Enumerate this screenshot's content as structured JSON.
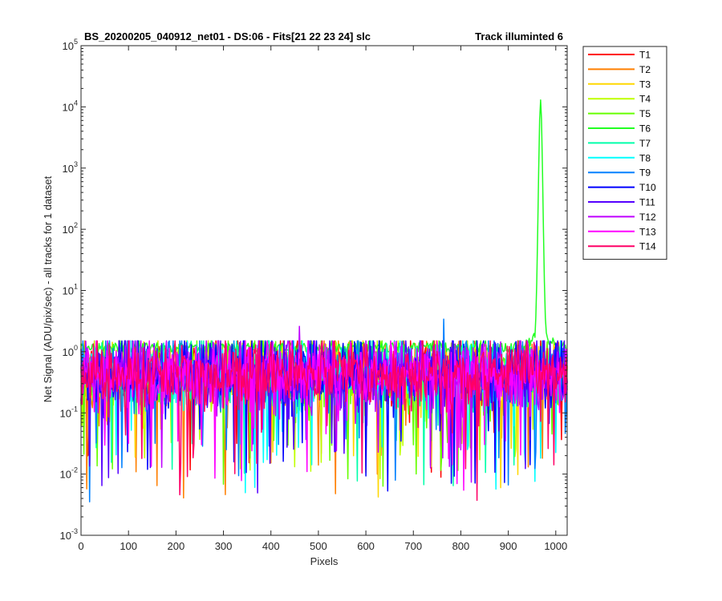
{
  "chart_data": {
    "type": "line",
    "title_left": "BS_20200205_040912_net01 - DS:06 - Fits[21  22  23  24]   slc",
    "title_right": "Track illuminted 6",
    "xlabel": "Pixels",
    "ylabel": "Net Signal (ADU/pix/sec) - all tracks for 1 dataset",
    "xlim": [
      0,
      1024
    ],
    "ylim": [
      0.001,
      100000
    ],
    "yscale": "log",
    "x_ticks": [
      "0",
      "100",
      "200",
      "300",
      "400",
      "500",
      "600",
      "700",
      "800",
      "900",
      "1000"
    ],
    "x_tick_values": [
      0,
      100,
      200,
      300,
      400,
      500,
      600,
      700,
      800,
      900,
      1000
    ],
    "y_tick_base": "10",
    "y_tick_exponents": [
      "-3",
      "-2",
      "-1",
      "0",
      "1",
      "2",
      "3",
      "4",
      "5"
    ],
    "legend_position": "outside-right-top",
    "grid": false,
    "noise_range": [
      0.003,
      1.5
    ],
    "series": [
      {
        "name": "T1",
        "color": "#ff0000"
      },
      {
        "name": "T2",
        "color": "#ff7f00"
      },
      {
        "name": "T3",
        "color": "#ffd700"
      },
      {
        "name": "T4",
        "color": "#bfff00"
      },
      {
        "name": "T5",
        "color": "#66ff00"
      },
      {
        "name": "T6",
        "color": "#22ff22",
        "features": [
          {
            "type": "peak",
            "x": 968,
            "y": 13000
          }
        ]
      },
      {
        "name": "T7",
        "color": "#00ffaa"
      },
      {
        "name": "T8",
        "color": "#00ffff"
      },
      {
        "name": "T9",
        "color": "#0080ff",
        "features": [
          {
            "type": "spike",
            "x": 764,
            "y": 3.4
          }
        ]
      },
      {
        "name": "T10",
        "color": "#0000ff"
      },
      {
        "name": "T11",
        "color": "#5500ff"
      },
      {
        "name": "T12",
        "color": "#bf00ff",
        "features": [
          {
            "type": "spike",
            "x": 460,
            "y": 2.6
          }
        ]
      },
      {
        "name": "T13",
        "color": "#ff00ff"
      },
      {
        "name": "T14",
        "color": "#ff0066"
      }
    ]
  }
}
